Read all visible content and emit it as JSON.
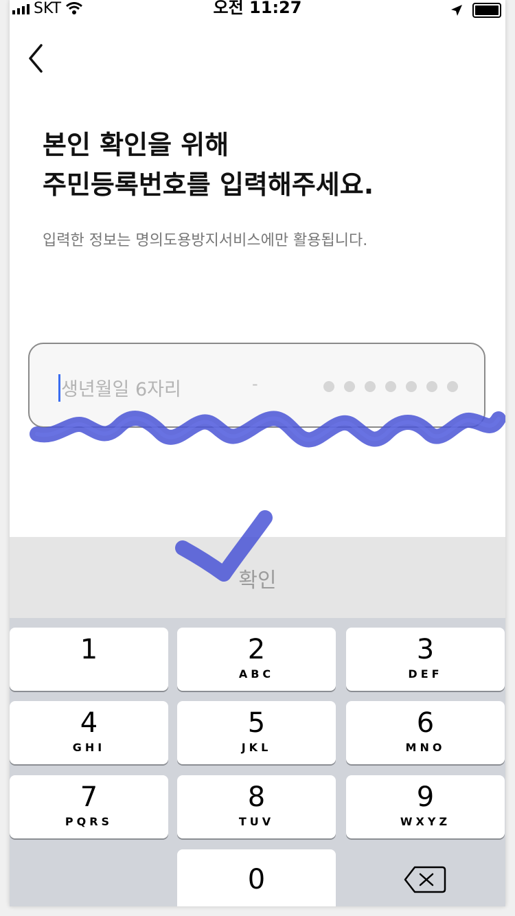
{
  "status_bar": {
    "carrier": "SKT",
    "time": "오전 11:27"
  },
  "header": {
    "title_line1": "본인 확인을 위해",
    "title_line2": "주민등록번호를 입력해주세요.",
    "subtitle": "입력한 정보는 명의도용방지서비스에만 활용됩니다."
  },
  "input": {
    "placeholder": "생년월일 6자리",
    "separator": "-",
    "masked_digits": 7
  },
  "confirm_button": {
    "label": "확인"
  },
  "keypad": {
    "keys": [
      {
        "num": "1",
        "letters": ""
      },
      {
        "num": "2",
        "letters": "ABC"
      },
      {
        "num": "3",
        "letters": "DEF"
      },
      {
        "num": "4",
        "letters": "GHI"
      },
      {
        "num": "5",
        "letters": "JKL"
      },
      {
        "num": "6",
        "letters": "MNO"
      },
      {
        "num": "7",
        "letters": "PQRS"
      },
      {
        "num": "8",
        "letters": "TUV"
      },
      {
        "num": "9",
        "letters": "WXYZ"
      },
      {
        "num": "0",
        "letters": ""
      }
    ]
  },
  "colors": {
    "accent": "#3a6df0",
    "scribble": "#4a55d6",
    "keypad_bg": "#d1d4da",
    "confirm_bg": "#e5e5e5"
  }
}
